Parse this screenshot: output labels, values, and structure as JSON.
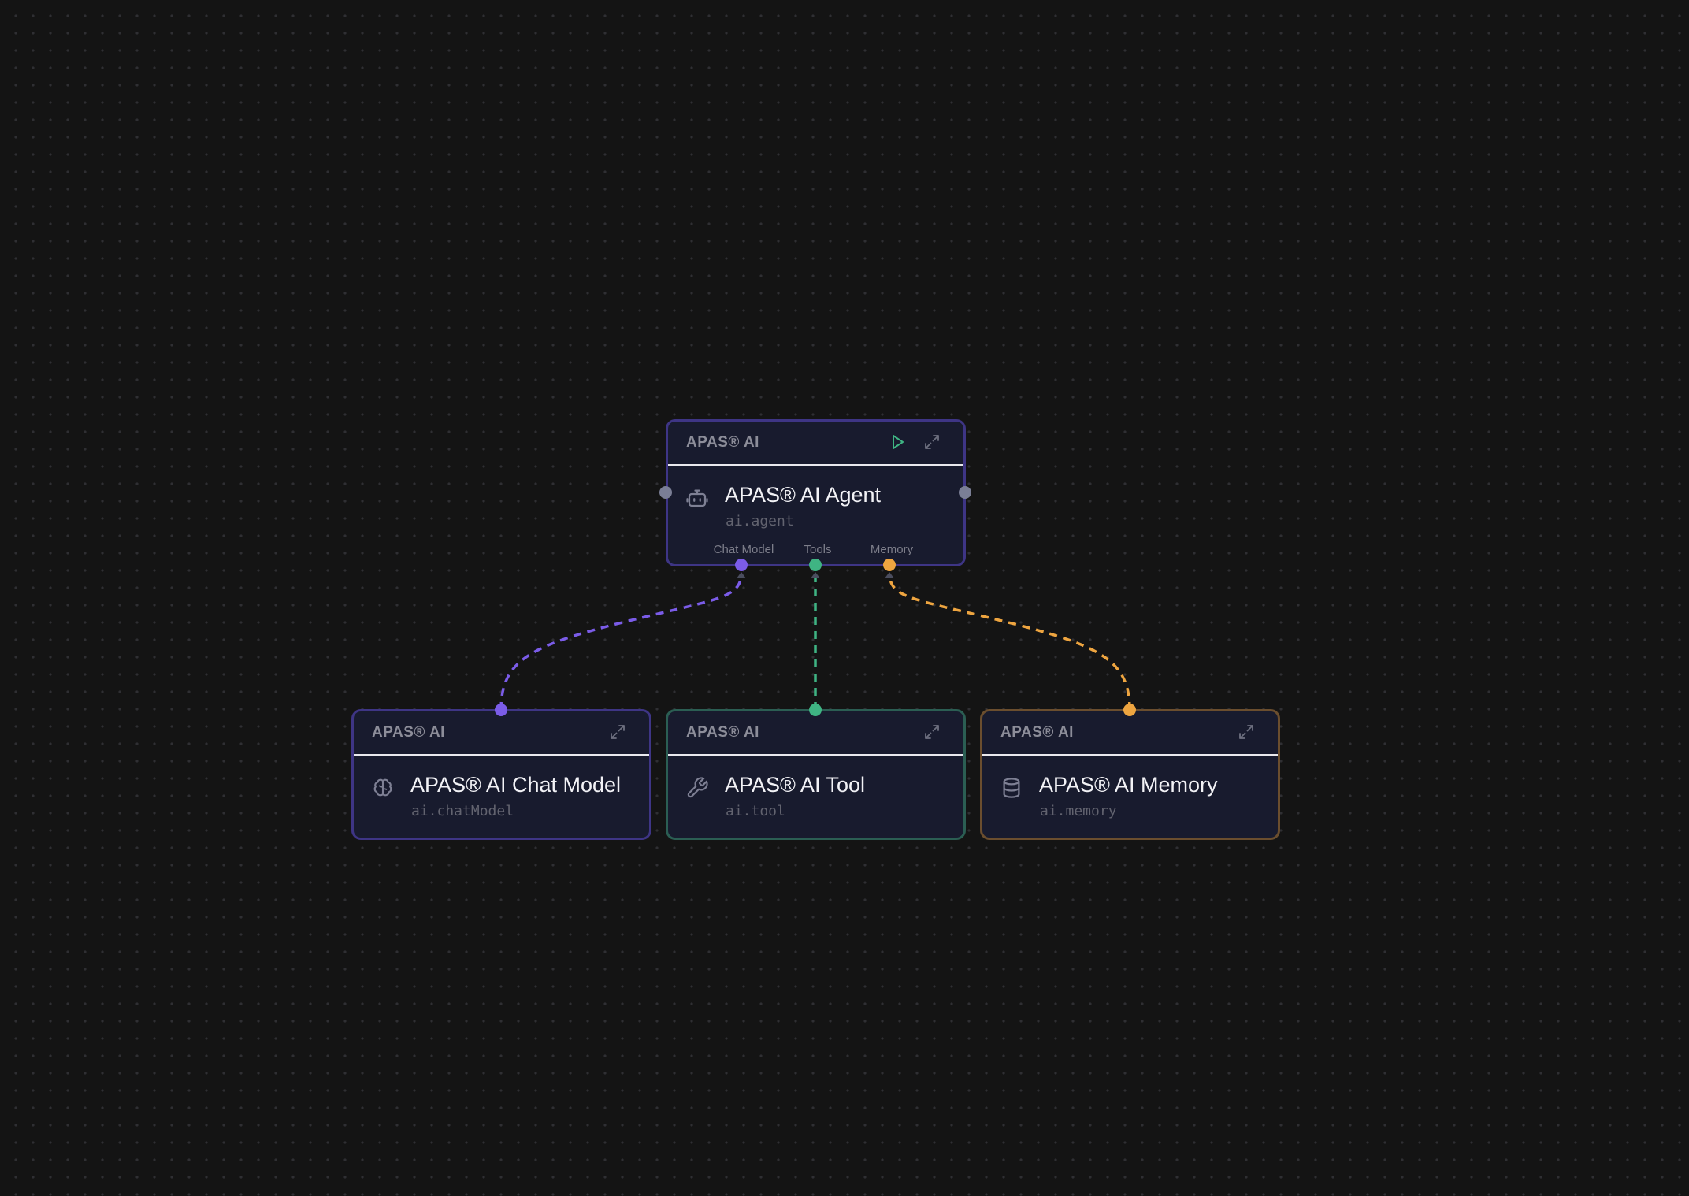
{
  "colors": {
    "background": "#141414",
    "node_bg": "#181b2e",
    "chat_model": "#7b5ce8",
    "tools": "#3fb483",
    "memory": "#eea540",
    "run_icon": "#3fb483",
    "side_handle": "#7a7e95"
  },
  "nodes": {
    "agent": {
      "category": "APAS® AI",
      "title": "APAS® AI Agent",
      "type": "ai.agent",
      "icon": "robot-icon",
      "ports": {
        "chat_model": "Chat Model",
        "tools": "Tools",
        "memory": "Memory"
      }
    },
    "chat_model": {
      "category": "APAS® AI",
      "title": "APAS® AI Chat Model",
      "type": "ai.chatModel",
      "icon": "brain-icon"
    },
    "tool": {
      "category": "APAS® AI",
      "title": "APAS® AI Tool",
      "type": "ai.tool",
      "icon": "wrench-icon"
    },
    "memory": {
      "category": "APAS® AI",
      "title": "APAS® AI Memory",
      "type": "ai.memory",
      "icon": "database-icon"
    }
  }
}
